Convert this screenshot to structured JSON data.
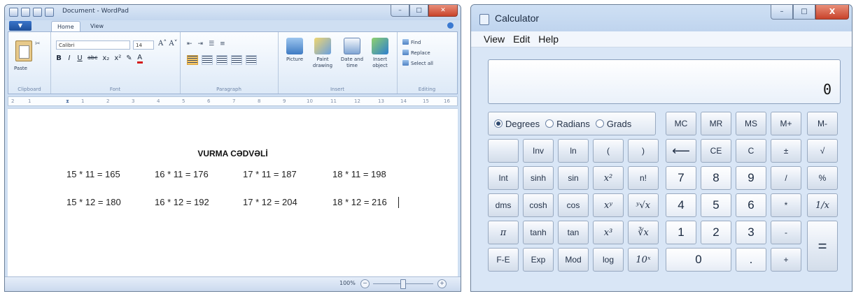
{
  "wordpad": {
    "title": "Document - WordPad",
    "tabs": [
      "Home",
      "View"
    ],
    "app_button": "▼",
    "groups": {
      "clipboard": {
        "label": "Clipboard",
        "paste": "Paste"
      },
      "font": {
        "label": "Font",
        "name": "Calibri",
        "size": "14",
        "grow": "A˄ A˅",
        "buttons": [
          "B",
          "I",
          "U",
          "abc",
          "x₂",
          "x²",
          "✎",
          "A"
        ]
      },
      "paragraph": {
        "label": "Paragraph",
        "row1": [
          "⇤",
          "⇥",
          "☰",
          "≡"
        ]
      },
      "insert": {
        "label": "Insert",
        "picture": "Picture",
        "paint": "Paint drawing",
        "datetime": "Date and time",
        "object": "Insert object"
      },
      "editing": {
        "label": "Editing",
        "find": "Find",
        "replace": "Replace",
        "select_all": "Select all"
      }
    },
    "ruler": [
      "2",
      "1",
      "1",
      "2",
      "3",
      "4",
      "5",
      "6",
      "7",
      "8",
      "9",
      "10",
      "11",
      "12",
      "13",
      "14",
      "15",
      "16"
    ],
    "document": {
      "heading": "VURMA CƏDVƏLİ",
      "rows": [
        [
          "15 * 11 = 165",
          "16 * 11 = 176",
          "17 * 11 = 187",
          "18 * 11 = 198"
        ],
        [
          "15 * 12 = 180",
          "16 * 12 = 192",
          "17 * 12 = 204",
          "18 * 12 = 216"
        ]
      ]
    },
    "status": {
      "zoom": "100%",
      "minus": "−",
      "plus": "+"
    }
  },
  "calculator": {
    "title": "Calculator",
    "menu": [
      "View",
      "Edit",
      "Help"
    ],
    "display": "0",
    "angle_units": {
      "options": [
        "Degrees",
        "Radians",
        "Grads"
      ],
      "selected": "Degrees"
    },
    "memory": [
      "MC",
      "MR",
      "MS",
      "M+",
      "M-"
    ],
    "rows": [
      [
        "",
        "Inv",
        "ln",
        "(",
        ")",
        "⟵",
        "CE",
        "C",
        "±",
        "√"
      ],
      [
        "Int",
        "sinh",
        "sin",
        "x²",
        "n!",
        "7",
        "8",
        "9",
        "/",
        "%"
      ],
      [
        "dms",
        "cosh",
        "cos",
        "xʸ",
        "ʸ√x",
        "4",
        "5",
        "6",
        "*",
        "1/x"
      ],
      [
        "π",
        "tanh",
        "tan",
        "x³",
        "∛x",
        "1",
        "2",
        "3",
        "-",
        "="
      ],
      [
        "F-E",
        "Exp",
        "Mod",
        "log",
        "10ˣ",
        "0",
        ".",
        "+"
      ]
    ]
  }
}
